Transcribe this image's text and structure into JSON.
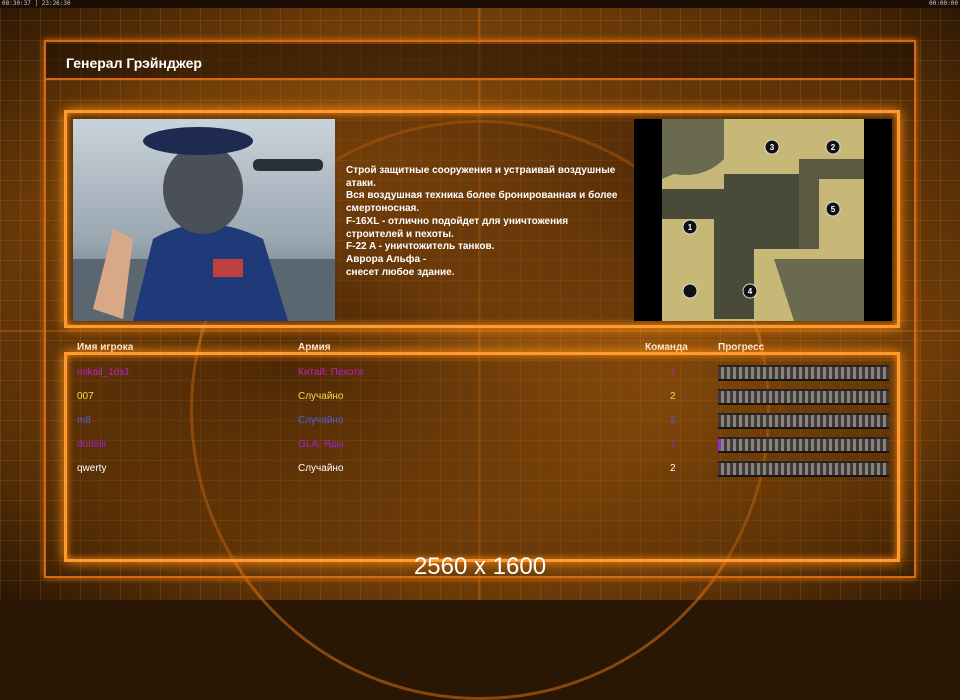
{
  "status_bar": {
    "left": "08:30:37 | 23:26:30",
    "right": "00:00:00"
  },
  "title": "Генерал Грэйнджер",
  "description": "Строй защитные сооружения и устраивай воздушные\n атаки.\nВся воздушная техника более бронированная и более\nсмертоносная.\nF-16XL - отлично подойдет для уничтожения\n строителей и пехоты.\nF-22 A - уничтожитель танков.\nАврора Альфа -\nснесет любое здание.",
  "map": {
    "start_positions": [
      "1",
      "2",
      "3",
      "4",
      "5"
    ]
  },
  "table": {
    "headers": {
      "player": "Имя игрока",
      "army": "Армия",
      "team": "Команда",
      "progress": "Прогресс"
    },
    "rows": [
      {
        "player": "mikail_1ds1",
        "army": "Китай: Пехота",
        "team": "1",
        "progress": 0,
        "color": "#c020c0"
      },
      {
        "player": "007",
        "army": "Случайно",
        "team": "2",
        "progress": 0,
        "color": "#e8e040"
      },
      {
        "player": "m8",
        "army": "Случайно",
        "team": "2",
        "progress": 0,
        "color": "#5060e0"
      },
      {
        "player": "dunaiii",
        "army": "GLA: Яды",
        "team": "1",
        "progress": 2,
        "color": "#a020d0"
      },
      {
        "player": "qwerty",
        "army": "Случайно",
        "team": "2",
        "progress": 0,
        "color": "#ffffff"
      }
    ]
  },
  "resolution": "2560 x 1600"
}
